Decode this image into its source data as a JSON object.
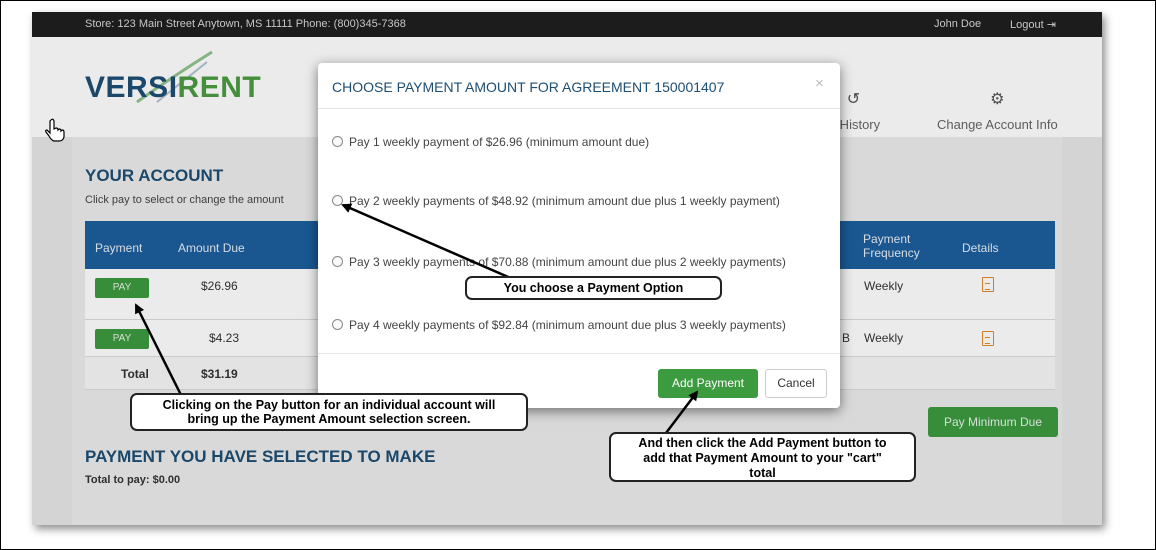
{
  "store_bar": {
    "store_text": "Store: 123 Main Street Anytown, MS 11111 Phone: (800)345-7368",
    "user_name": "John Doe",
    "logout_label": "Logout"
  },
  "header": {
    "logo_part1": "VERSI",
    "logo_part2": "RENT",
    "nav": [
      {
        "label": "ent History",
        "icon": "history-icon"
      },
      {
        "label": "Change Account Info",
        "icon": "gear-icon"
      }
    ]
  },
  "account": {
    "title": "YOUR ACCOUNT",
    "subtitle": "Click pay to select or change the amount",
    "columns": [
      "Payment",
      "Amount Due",
      "Payment Frequency",
      "Details"
    ],
    "payment_frequency_line1": "Payment",
    "payment_frequency_line2": "Frequency",
    "rows": [
      {
        "pay_label": "PAY",
        "amount": "$26.96",
        "frequency": "Weekly",
        "partial_text": ""
      },
      {
        "pay_label": "PAY",
        "amount": "$4.23",
        "frequency": "Weekly",
        "partial_text": "B"
      }
    ],
    "total_label": "Total",
    "total_amount": "$31.19",
    "pay_minimum_label": "Pay Minimum Due",
    "selected_title": "PAYMENT YOU HAVE SELECTED TO MAKE",
    "total_to_pay": "Total to pay: $0.00"
  },
  "modal": {
    "title": "CHOOSE PAYMENT AMOUNT FOR AGREEMENT 150001407",
    "close_glyph": "×",
    "options": [
      "Pay 1 weekly payment of $26.96 (minimum amount due)",
      "Pay 2 weekly payments of $48.92 (minimum amount due plus 1 weekly payment)",
      "Pay 3 weekly payments of $70.88 (minimum amount due plus 2 weekly payments)",
      "Pay 4 weekly payments of $92.84 (minimum amount due plus 3 weekly payments)"
    ],
    "add_label": "Add Payment",
    "cancel_label": "Cancel"
  },
  "callouts": {
    "choose": "You choose a Payment Option",
    "pay_button_line1": "Clicking on the Pay button for an individual account will",
    "pay_button_line2": "bring up the Payment Amount selection screen.",
    "add_line1": "And then click the Add Payment button to",
    "add_line2": "add that Payment Amount to your \"cart\"",
    "add_line3": "total"
  },
  "colors": {
    "brand_blue": "#1d4e73",
    "brand_green": "#4a9b42",
    "table_header": "#1d5f9e",
    "button_green": "#3c9a3f",
    "doc_icon": "#e08a2c"
  }
}
